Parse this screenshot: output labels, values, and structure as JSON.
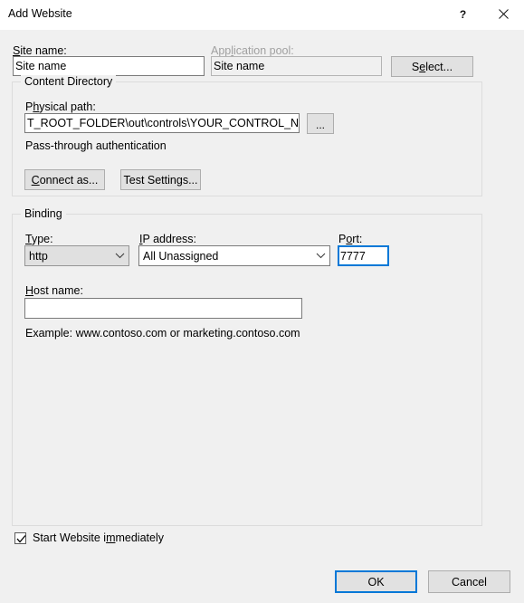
{
  "window": {
    "title": "Add Website",
    "help_icon": "question-mark-icon",
    "close_icon": "close-icon"
  },
  "site_name": {
    "label_pre": "S",
    "label_post": "ite name:",
    "value": "Site name"
  },
  "app_pool": {
    "label_pre": "App",
    "label_acc": "l",
    "label_post": "ication pool:",
    "value": "Site name",
    "select_button": {
      "pre": "S",
      "acc": "e",
      "post": "lect..."
    }
  },
  "content_directory": {
    "title": "Content Directory",
    "physical_path": {
      "label_pre": "P",
      "label_acc": "h",
      "label_post": "ysical path:",
      "value": "T_ROOT_FOLDER\\out\\controls\\YOUR_CONTROL_NAME\\"
    },
    "browse_button": "...",
    "passthrough_text": "Pass-through authentication",
    "connect_as_button": {
      "pre": "",
      "acc": "C",
      "post": "onnect as..."
    },
    "test_settings_button": {
      "pre": "Test Settin",
      "acc": "g",
      "post": "s..."
    }
  },
  "binding": {
    "title": "Binding",
    "type": {
      "label_pre": "",
      "label_acc": "T",
      "label_post": "ype:",
      "value": "http"
    },
    "ip_address": {
      "label_pre": "",
      "label_acc": "I",
      "label_post": "P address:",
      "value": "All Unassigned"
    },
    "port": {
      "label_pre": "P",
      "label_acc": "o",
      "label_post": "rt:",
      "value": "7777"
    },
    "host_name": {
      "label_pre": "",
      "label_acc": "H",
      "label_post": "ost name:",
      "value": ""
    },
    "example_text": "Example: www.contoso.com or marketing.contoso.com"
  },
  "footer": {
    "start_website": {
      "checked": true,
      "label_pre": "Start Website i",
      "label_acc": "m",
      "label_post": "mediately"
    },
    "ok_button": "OK",
    "cancel_button": "Cancel"
  },
  "colors": {
    "accent": "#0078d7",
    "dialog_bg": "#f0f0f0",
    "titlebar_bg": "#ffffff",
    "button_face": "#e1e1e1",
    "disabled_text": "#a0a0a0"
  }
}
